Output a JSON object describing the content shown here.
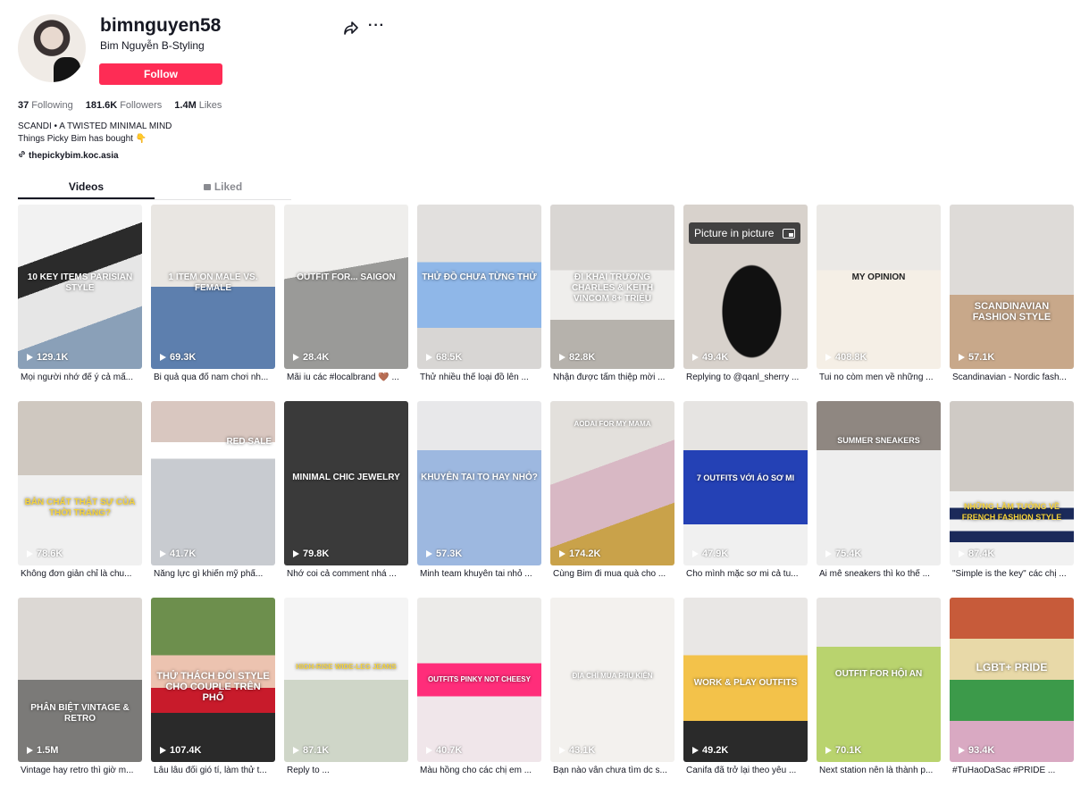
{
  "profile": {
    "username": "bimnguyen58",
    "nickname": "Bim Nguyễn B-Styling",
    "follow_label": "Follow",
    "share_icon": "share-arrow-icon",
    "more_icon": "more-dots-icon",
    "more_text": "···"
  },
  "stats": [
    {
      "value": "37",
      "label": "Following"
    },
    {
      "value": "181.6K",
      "label": "Followers"
    },
    {
      "value": "1.4M",
      "label": "Likes"
    }
  ],
  "bio": {
    "line1": "SCANDI • A TWISTED MINIMAL MIND",
    "line2": "Things Picky Bim has bought 👇",
    "link": "thepickybim.koc.asia"
  },
  "tabs": {
    "videos": "Videos",
    "liked": "Liked"
  },
  "pip": {
    "label": "Picture in picture"
  },
  "videos": [
    {
      "plays": "129.1K",
      "caption": "Mọi người nhớ để ý cả mấ...",
      "overlay": "10 KEY ITEMS PARISIAN STYLE"
    },
    {
      "plays": "69.3K",
      "caption": "Bi quả qua đổ nam chơi nh...",
      "overlay": "1 ITEM ON MALE vs. FEMALE"
    },
    {
      "plays": "28.4K",
      "caption": "Mãi iu các #localbrand 🤎 ...",
      "overlay": "OUTFIT FOR... Saigon"
    },
    {
      "plays": "68.5K",
      "caption": "Thử nhiều thể loại đồ lên ...",
      "overlay": "THỬ ĐỒ CHƯA TỪNG THỬ"
    },
    {
      "plays": "82.8K",
      "caption": "Nhận được tấm thiệp mời ...",
      "overlay": "ĐI KHAI TRƯƠNG CHARLES & KEITH VINCOM 8+ TRIỆU"
    },
    {
      "plays": "49.4K",
      "caption": "Replying to @qanl_sherry ...",
      "overlay": ""
    },
    {
      "plays": "408.8K",
      "caption": "Tui no còm men về những ...",
      "overlay": "MY OPINION"
    },
    {
      "plays": "57.1K",
      "caption": "Scandinavian - Nordic fash...",
      "overlay": "SCANDINAVIAN FASHION STYLE"
    },
    {
      "plays": "78.6K",
      "caption": "Không đơn giản chỉ là chu...",
      "overlay": "BẢN CHẤT THẬT SỰ CỦA THỜI TRANG?"
    },
    {
      "plays": "41.7K",
      "caption": "Năng lực gì khiến mỹ phẩ...",
      "overlay": "RED SALE"
    },
    {
      "plays": "79.8K",
      "caption": "Nhớ coi cả comment nhá ...",
      "overlay": "MINIMAL CHIC JEWELRY"
    },
    {
      "plays": "57.3K",
      "caption": "Minh team khuyên tai nhỏ ...",
      "overlay": "KHUYÊN TAI TO HAY NHỎ?"
    },
    {
      "plays": "174.2K",
      "caption": "Cùng Bim đi mua quà cho ...",
      "overlay": "AODAI FOR MY MAMA"
    },
    {
      "plays": "47.9K",
      "caption": "Cho mình mặc sơ mi cả tu...",
      "overlay": "7 OUTFITS VỚI ÁO SƠ MI"
    },
    {
      "plays": "75.4K",
      "caption": "Ai mê sneakers thì ko thể ...",
      "overlay": "SUMMER SNEAKERS"
    },
    {
      "plays": "87.4K",
      "caption": "\"Simple is the key\" các chị ...",
      "overlay": "NHỮNG LẦM TƯỞNG VỀ FRENCH FASHION STYLE"
    },
    {
      "plays": "1.5M",
      "caption": "Vintage hay retro thì giờ m...",
      "overlay": "PHÂN BIỆT VINTAGE & RETRO"
    },
    {
      "plays": "107.4K",
      "caption": "Lâu lâu đổi gió tí, làm thử t...",
      "overlay": "THỬ THÁCH ĐỔI STYLE CHO COUPLE TRÊN PHỐ"
    },
    {
      "plays": "87.1K",
      "caption": "Reply to ...",
      "overlay": "HIGH-RISE WIDE-LEG JEANS"
    },
    {
      "plays": "40.7K",
      "caption": "Màu hồng cho các chị em ...",
      "overlay": "OUTFITS PINKY NOT CHEESY"
    },
    {
      "plays": "43.1K",
      "caption": "Bạn nào vẫn chưa tìm dc s...",
      "overlay": "ĐỊA CHỈ MUA PHỤ KIỆN"
    },
    {
      "plays": "49.2K",
      "caption": "Canifa đã trở lại theo yêu ...",
      "overlay": "WORK & PLAY OUTFITS"
    },
    {
      "plays": "70.1K",
      "caption": "Next station nên là thành p...",
      "overlay": "OUTFIT FOR HỘI AN"
    },
    {
      "plays": "93.4K",
      "caption": "#TuHaoDaSac #PRIDE ...",
      "overlay": "LGBT+ PRIDE"
    }
  ]
}
